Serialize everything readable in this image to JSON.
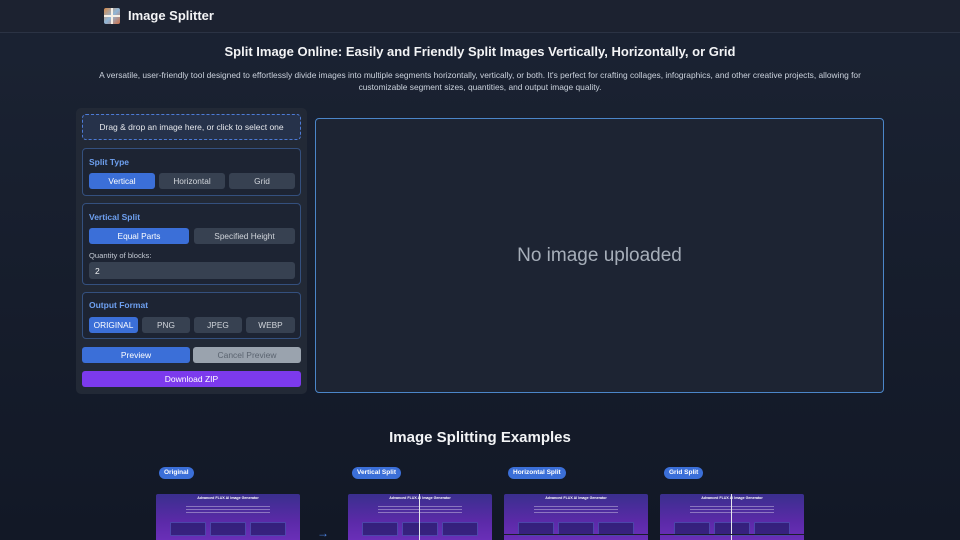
{
  "header": {
    "app_title": "Image Splitter",
    "logo_icon": "image-splitter-logo"
  },
  "hero": {
    "title": "Split Image Online: Easily and Friendly Split Images Vertically, Horizontally, or Grid",
    "description": "A versatile, user-friendly tool designed to effortlessly divide images into multiple segments horizontally, vertically, or both. It's perfect for crafting collages, infographics, and other creative projects, allowing for customizable segment sizes, quantities, and output image quality."
  },
  "dropzone": {
    "label": "Drag & drop an image here, or click to select one"
  },
  "split_type": {
    "title": "Split Type",
    "options": [
      "Vertical",
      "Horizontal",
      "Grid"
    ],
    "selected": "Vertical"
  },
  "vertical_split": {
    "title": "Vertical Split",
    "modes": [
      "Equal Parts",
      "Specified Height"
    ],
    "selected": "Equal Parts",
    "quantity_label": "Quantity of blocks:",
    "quantity_value": "2"
  },
  "output_format": {
    "title": "Output Format",
    "options": [
      "ORIGINAL",
      "PNG",
      "JPEG",
      "WEBP"
    ],
    "selected": "ORIGINAL"
  },
  "actions": {
    "preview": "Preview",
    "cancel_preview": "Cancel Preview",
    "download_zip": "Download ZIP"
  },
  "preview": {
    "empty_text": "No image uploaded"
  },
  "examples": {
    "title": "Image Splitting Examples",
    "badges": [
      "Original",
      "Vertical Split",
      "Horizontal Split",
      "Grid Split"
    ],
    "thumb_title": "Advanced FLUX AI Image Generator",
    "arrow_icon": "arrow-right-icon"
  },
  "colors": {
    "accent": "#3b6fd8",
    "zip": "#7c3aed",
    "border": "#34507e",
    "background": "#121826"
  }
}
